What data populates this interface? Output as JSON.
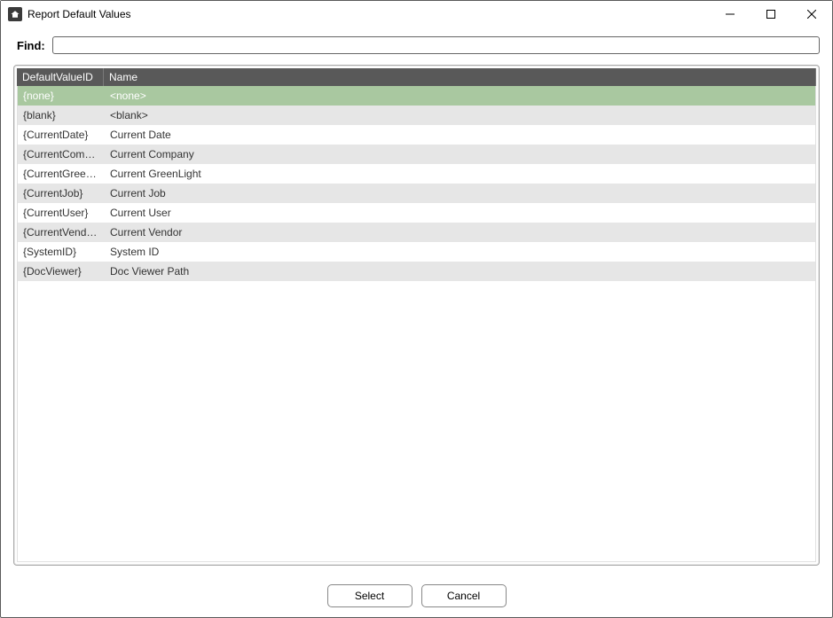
{
  "window": {
    "title": "Report Default Values"
  },
  "find": {
    "label": "Find:",
    "value": ""
  },
  "grid": {
    "headers": {
      "col1": "DefaultValueID",
      "col2": "Name"
    },
    "selected_index": 0,
    "rows": [
      {
        "id": "{none}",
        "name": "<none>"
      },
      {
        "id": "{blank}",
        "name": "<blank>"
      },
      {
        "id": "{CurrentDate}",
        "name": "Current Date"
      },
      {
        "id": "{CurrentCompany}",
        "name": "Current Company"
      },
      {
        "id": "{CurrentGreenLig...",
        "name": "Current GreenLight"
      },
      {
        "id": "{CurrentJob}",
        "name": "Current Job"
      },
      {
        "id": "{CurrentUser}",
        "name": "Current User"
      },
      {
        "id": "{CurrentVendor}",
        "name": "Current Vendor"
      },
      {
        "id": "{SystemID}",
        "name": "System ID"
      },
      {
        "id": "{DocViewer}",
        "name": "Doc Viewer Path"
      }
    ]
  },
  "footer": {
    "select_label": "Select",
    "cancel_label": "Cancel"
  }
}
